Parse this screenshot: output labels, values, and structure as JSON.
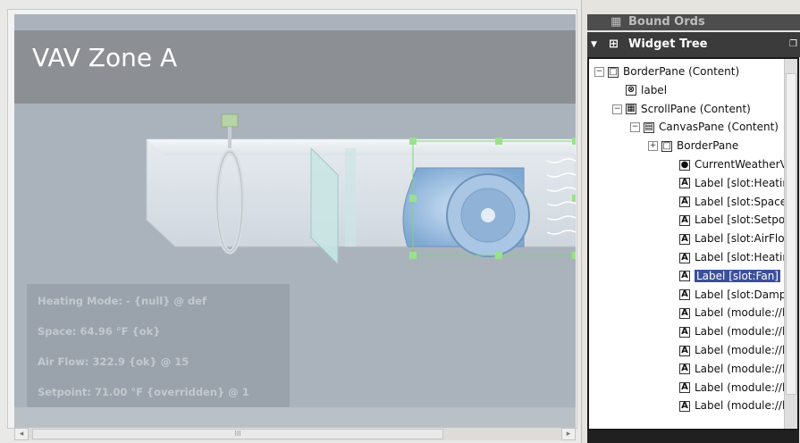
{
  "canvas": {
    "title": "VAV Zone A",
    "status_lines": [
      "Heating Mode: - {null} @ def",
      "Space: 64.96 °F {ok}",
      "Air Flow: 322.9 {ok} @ 15",
      "Setpoint: 71.00 °F {overridden} @ 1"
    ]
  },
  "side_panel": {
    "bound_ords_title": "Bound Ords",
    "widget_tree_title": "Widget Tree",
    "tree": [
      {
        "text": "BorderPane (Content)",
        "expander": "−",
        "icon": "□"
      },
      {
        "text": "label",
        "expander": "",
        "icon": "⊗"
      },
      {
        "text": "ScrollPane (Content)",
        "expander": "−",
        "icon": "▦"
      },
      {
        "text": "CanvasPane (Content)",
        "expander": "−",
        "icon": "▤"
      },
      {
        "text": "BorderPane",
        "expander": "+",
        "icon": "□"
      },
      {
        "text": "CurrentWeatherVie",
        "expander": "",
        "icon": "●"
      },
      {
        "text": "Label [slot:HeatingN",
        "expander": "",
        "icon": "A"
      },
      {
        "text": "Label [slot:SpaceTe",
        "expander": "",
        "icon": "A"
      },
      {
        "text": "Label [slot:Setpoint",
        "expander": "",
        "icon": "A"
      },
      {
        "text": "Label [slot:AirFlow]",
        "expander": "",
        "icon": "A"
      },
      {
        "text": "Label [slot:Heating(",
        "expander": "",
        "icon": "A"
      },
      {
        "text": "Label [slot:Fan]",
        "expander": "",
        "icon": "A",
        "selected": true
      },
      {
        "text": "Label [slot:DamperF",
        "expander": "",
        "icon": "A"
      },
      {
        "text": "Label (module://kitF",
        "expander": "",
        "icon": "A"
      },
      {
        "text": "Label (module://kitF",
        "expander": "",
        "icon": "A"
      },
      {
        "text": "Label (module://kitF",
        "expander": "",
        "icon": "A"
      },
      {
        "text": "Label (module://kitF",
        "expander": "",
        "icon": "A"
      },
      {
        "text": "Label (module://kitF",
        "expander": "",
        "icon": "A"
      },
      {
        "text": "Label (module://kitF",
        "expander": "",
        "icon": "A"
      }
    ]
  },
  "scroll": {
    "thumb_grip": "III"
  },
  "colors": {
    "canvas_bg": "#aab3bb",
    "title_band": "#8c8f94",
    "header_dark": "#3b3b3b",
    "selection": "#3c4f9b"
  }
}
